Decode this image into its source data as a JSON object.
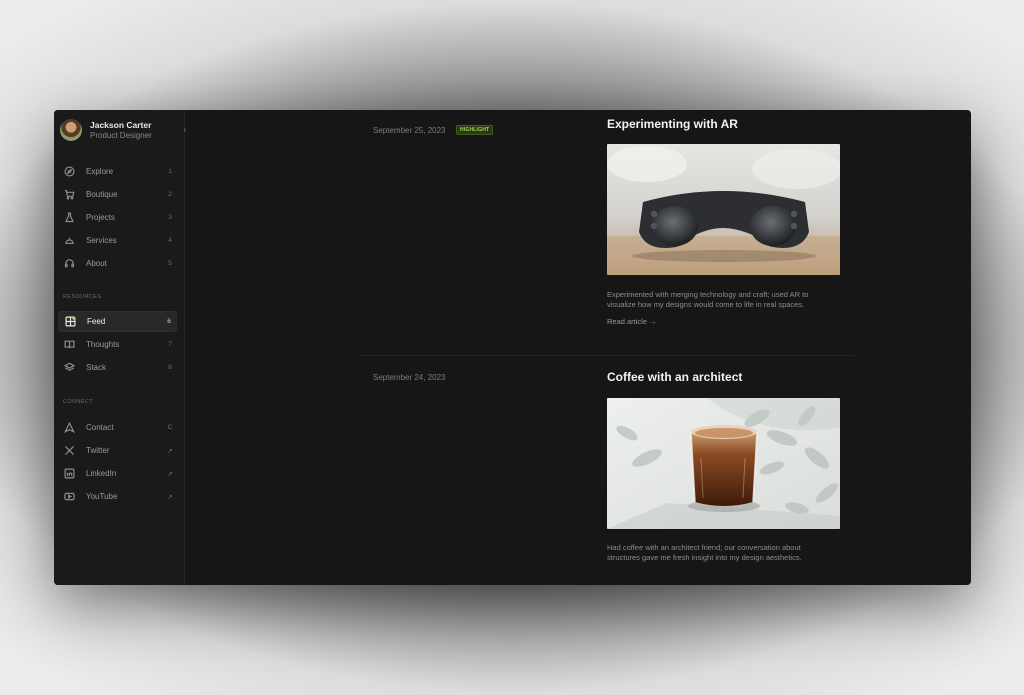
{
  "profile": {
    "name": "Jackson Carter",
    "role": "Product Designer"
  },
  "nav": {
    "main": [
      {
        "label": "Explore",
        "key": "1",
        "icon": "compass-icon"
      },
      {
        "label": "Boutique",
        "key": "2",
        "icon": "cart-icon"
      },
      {
        "label": "Projects",
        "key": "3",
        "icon": "flask-icon"
      },
      {
        "label": "Services",
        "key": "4",
        "icon": "cloche-icon"
      },
      {
        "label": "About",
        "key": "5",
        "icon": "headset-icon"
      }
    ],
    "resources_title": "RESOURCES",
    "resources": [
      {
        "label": "Feed",
        "key": "6",
        "icon": "feed-grid-icon",
        "active": true
      },
      {
        "label": "Thoughts",
        "key": "7",
        "icon": "book-icon"
      },
      {
        "label": "Stack",
        "key": "8",
        "icon": "layers-icon"
      }
    ],
    "connect_title": "CONNECT",
    "connect": [
      {
        "label": "Contact",
        "key": "C",
        "icon": "send-icon"
      },
      {
        "label": "Twitter",
        "key": "↗",
        "icon": "x-logo-icon"
      },
      {
        "label": "LinkedIn",
        "key": "↗",
        "icon": "linkedin-icon"
      },
      {
        "label": "YouTube",
        "key": "↗",
        "icon": "youtube-icon"
      }
    ]
  },
  "posts": [
    {
      "date": "September 25, 2023",
      "badge": "HIGHLIGHT",
      "title": "Experimenting with AR",
      "description_lines": [
        "Experimented with merging technology and craft; used AR to",
        "visualize how my designs would come to life in real spaces."
      ],
      "link": "Read article →"
    },
    {
      "date": "September 24, 2023",
      "title": "Coffee with an architect",
      "description_lines": [
        "Had coffee with an architect friend; our conversation about",
        "structures gave me fresh insight into my design aesthetics."
      ]
    }
  ],
  "colors": {
    "background": "#161616",
    "sidebar": "#1a1a1a",
    "badge_text": "#a6d35a",
    "badge_bg": "#2b3a16"
  }
}
